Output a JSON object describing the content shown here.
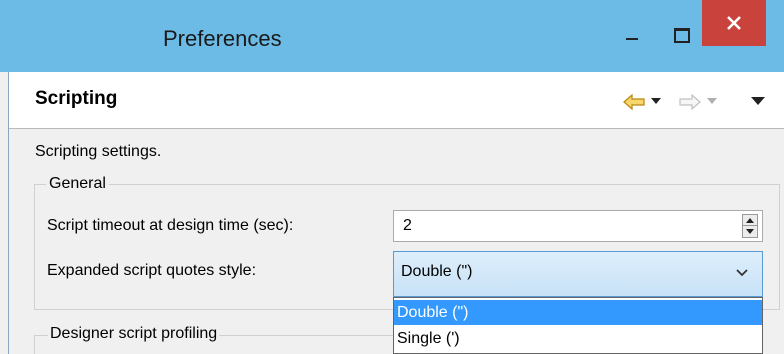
{
  "window": {
    "title": "Preferences",
    "controls": {
      "minimize": "minimize-icon",
      "maximize": "maximize-icon",
      "close": "close-icon"
    },
    "accent_color": "#6cbbe6",
    "close_color": "#c9433c"
  },
  "header": {
    "title": "Scripting",
    "nav_icons": [
      "back-arrow-icon",
      "dropdown-arrow-icon",
      "forward-arrow-icon",
      "dropdown-arrow-icon",
      "view-menu-icon"
    ]
  },
  "page": {
    "description": "Scripting settings."
  },
  "general": {
    "group_label": "General",
    "timeout_label": "Script timeout at design time (sec):",
    "timeout_value": "2",
    "quotes_label": "Expanded script quotes style:",
    "quotes_value": "Double (\")",
    "quotes_options": [
      "Double (\")",
      "Single (')"
    ],
    "selected_color": "#3399ff"
  },
  "profiling": {
    "group_label": "Designer script profiling"
  }
}
